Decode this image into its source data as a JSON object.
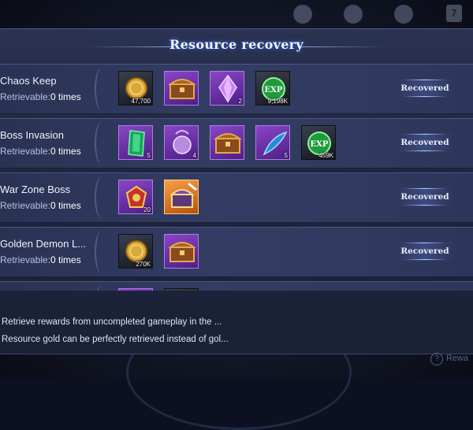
{
  "title": "Resource recovery",
  "top_icons": [
    "avatar-icon",
    "guild-icon",
    "rank-icon",
    "card-icon"
  ],
  "top_card_number": "7",
  "rows": [
    {
      "name": "Chaos Keep",
      "retrievable_label": "Retrievable:",
      "retrievable_count": "0 times",
      "button": "Recovered",
      "items": [
        {
          "icon": "gold-coin-icon",
          "rarity": "dark",
          "qty": "47,700"
        },
        {
          "icon": "treasure-chest-icon",
          "rarity": "purple",
          "qty": ""
        },
        {
          "icon": "purple-crystal-icon",
          "rarity": "purple",
          "qty": "2"
        },
        {
          "icon": "exp-orb-icon",
          "rarity": "dark",
          "qty": "9,198K"
        }
      ]
    },
    {
      "name": "Boss Invasion",
      "retrievable_label": "Retrievable:",
      "retrievable_count": "0 times",
      "button": "Recovered",
      "items": [
        {
          "icon": "green-gem-icon",
          "rarity": "purple",
          "qty": "5"
        },
        {
          "icon": "purple-orb-icon",
          "rarity": "purple",
          "qty": "4"
        },
        {
          "icon": "treasure-chest-icon",
          "rarity": "purple",
          "qty": ""
        },
        {
          "icon": "feather-quill-icon",
          "rarity": "purple",
          "qty": "5"
        },
        {
          "icon": "exp-orb-icon",
          "rarity": "dark",
          "qty": "459K"
        }
      ]
    },
    {
      "name": "War Zone Boss",
      "retrievable_label": "Retrievable:",
      "retrievable_count": "0 times",
      "button": "Recovered",
      "items": [
        {
          "icon": "red-emblem-icon",
          "rarity": "purple",
          "qty": "20"
        },
        {
          "icon": "dragon-chest-icon",
          "rarity": "orange",
          "qty": ""
        }
      ]
    },
    {
      "name": "Golden Demon L...",
      "retrievable_label": "Retrievable:",
      "retrievable_count": "0 times",
      "button": "Recovered",
      "items": [
        {
          "icon": "gold-coin-icon",
          "rarity": "dark",
          "qty": "270K"
        },
        {
          "icon": "treasure-chest-icon",
          "rarity": "purple",
          "qty": ""
        }
      ]
    },
    {
      "name": "",
      "retrievable_label": "",
      "retrievable_count": "",
      "button": "",
      "items": [
        {
          "icon": "purple-item-icon",
          "rarity": "purple",
          "qty": ""
        },
        {
          "icon": "dark-item-icon",
          "rarity": "dark",
          "qty": ""
        }
      ]
    }
  ],
  "footer": {
    "line1": "Retrieve rewards from uncompleted gameplay in the ...",
    "line2": "Resource gold can be perfectly retrieved instead of gol..."
  },
  "help_label": "Rewa"
}
